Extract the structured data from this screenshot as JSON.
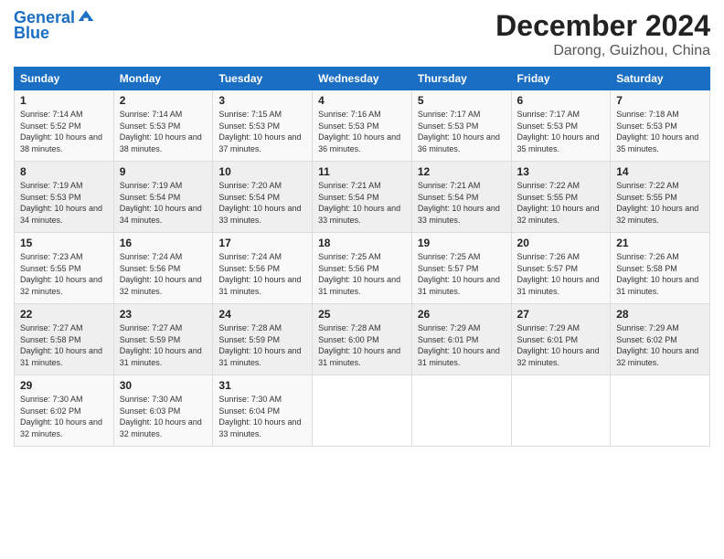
{
  "header": {
    "logo_line1": "General",
    "logo_line2": "Blue",
    "month": "December 2024",
    "location": "Darong, Guizhou, China"
  },
  "weekdays": [
    "Sunday",
    "Monday",
    "Tuesday",
    "Wednesday",
    "Thursday",
    "Friday",
    "Saturday"
  ],
  "weeks": [
    [
      {
        "day": "1",
        "sunrise": "Sunrise: 7:14 AM",
        "sunset": "Sunset: 5:52 PM",
        "daylight": "Daylight: 10 hours and 38 minutes."
      },
      {
        "day": "2",
        "sunrise": "Sunrise: 7:14 AM",
        "sunset": "Sunset: 5:53 PM",
        "daylight": "Daylight: 10 hours and 38 minutes."
      },
      {
        "day": "3",
        "sunrise": "Sunrise: 7:15 AM",
        "sunset": "Sunset: 5:53 PM",
        "daylight": "Daylight: 10 hours and 37 minutes."
      },
      {
        "day": "4",
        "sunrise": "Sunrise: 7:16 AM",
        "sunset": "Sunset: 5:53 PM",
        "daylight": "Daylight: 10 hours and 36 minutes."
      },
      {
        "day": "5",
        "sunrise": "Sunrise: 7:17 AM",
        "sunset": "Sunset: 5:53 PM",
        "daylight": "Daylight: 10 hours and 36 minutes."
      },
      {
        "day": "6",
        "sunrise": "Sunrise: 7:17 AM",
        "sunset": "Sunset: 5:53 PM",
        "daylight": "Daylight: 10 hours and 35 minutes."
      },
      {
        "day": "7",
        "sunrise": "Sunrise: 7:18 AM",
        "sunset": "Sunset: 5:53 PM",
        "daylight": "Daylight: 10 hours and 35 minutes."
      }
    ],
    [
      {
        "day": "8",
        "sunrise": "Sunrise: 7:19 AM",
        "sunset": "Sunset: 5:53 PM",
        "daylight": "Daylight: 10 hours and 34 minutes."
      },
      {
        "day": "9",
        "sunrise": "Sunrise: 7:19 AM",
        "sunset": "Sunset: 5:54 PM",
        "daylight": "Daylight: 10 hours and 34 minutes."
      },
      {
        "day": "10",
        "sunrise": "Sunrise: 7:20 AM",
        "sunset": "Sunset: 5:54 PM",
        "daylight": "Daylight: 10 hours and 33 minutes."
      },
      {
        "day": "11",
        "sunrise": "Sunrise: 7:21 AM",
        "sunset": "Sunset: 5:54 PM",
        "daylight": "Daylight: 10 hours and 33 minutes."
      },
      {
        "day": "12",
        "sunrise": "Sunrise: 7:21 AM",
        "sunset": "Sunset: 5:54 PM",
        "daylight": "Daylight: 10 hours and 33 minutes."
      },
      {
        "day": "13",
        "sunrise": "Sunrise: 7:22 AM",
        "sunset": "Sunset: 5:55 PM",
        "daylight": "Daylight: 10 hours and 32 minutes."
      },
      {
        "day": "14",
        "sunrise": "Sunrise: 7:22 AM",
        "sunset": "Sunset: 5:55 PM",
        "daylight": "Daylight: 10 hours and 32 minutes."
      }
    ],
    [
      {
        "day": "15",
        "sunrise": "Sunrise: 7:23 AM",
        "sunset": "Sunset: 5:55 PM",
        "daylight": "Daylight: 10 hours and 32 minutes."
      },
      {
        "day": "16",
        "sunrise": "Sunrise: 7:24 AM",
        "sunset": "Sunset: 5:56 PM",
        "daylight": "Daylight: 10 hours and 32 minutes."
      },
      {
        "day": "17",
        "sunrise": "Sunrise: 7:24 AM",
        "sunset": "Sunset: 5:56 PM",
        "daylight": "Daylight: 10 hours and 31 minutes."
      },
      {
        "day": "18",
        "sunrise": "Sunrise: 7:25 AM",
        "sunset": "Sunset: 5:56 PM",
        "daylight": "Daylight: 10 hours and 31 minutes."
      },
      {
        "day": "19",
        "sunrise": "Sunrise: 7:25 AM",
        "sunset": "Sunset: 5:57 PM",
        "daylight": "Daylight: 10 hours and 31 minutes."
      },
      {
        "day": "20",
        "sunrise": "Sunrise: 7:26 AM",
        "sunset": "Sunset: 5:57 PM",
        "daylight": "Daylight: 10 hours and 31 minutes."
      },
      {
        "day": "21",
        "sunrise": "Sunrise: 7:26 AM",
        "sunset": "Sunset: 5:58 PM",
        "daylight": "Daylight: 10 hours and 31 minutes."
      }
    ],
    [
      {
        "day": "22",
        "sunrise": "Sunrise: 7:27 AM",
        "sunset": "Sunset: 5:58 PM",
        "daylight": "Daylight: 10 hours and 31 minutes."
      },
      {
        "day": "23",
        "sunrise": "Sunrise: 7:27 AM",
        "sunset": "Sunset: 5:59 PM",
        "daylight": "Daylight: 10 hours and 31 minutes."
      },
      {
        "day": "24",
        "sunrise": "Sunrise: 7:28 AM",
        "sunset": "Sunset: 5:59 PM",
        "daylight": "Daylight: 10 hours and 31 minutes."
      },
      {
        "day": "25",
        "sunrise": "Sunrise: 7:28 AM",
        "sunset": "Sunset: 6:00 PM",
        "daylight": "Daylight: 10 hours and 31 minutes."
      },
      {
        "day": "26",
        "sunrise": "Sunrise: 7:29 AM",
        "sunset": "Sunset: 6:01 PM",
        "daylight": "Daylight: 10 hours and 31 minutes."
      },
      {
        "day": "27",
        "sunrise": "Sunrise: 7:29 AM",
        "sunset": "Sunset: 6:01 PM",
        "daylight": "Daylight: 10 hours and 32 minutes."
      },
      {
        "day": "28",
        "sunrise": "Sunrise: 7:29 AM",
        "sunset": "Sunset: 6:02 PM",
        "daylight": "Daylight: 10 hours and 32 minutes."
      }
    ],
    [
      {
        "day": "29",
        "sunrise": "Sunrise: 7:30 AM",
        "sunset": "Sunset: 6:02 PM",
        "daylight": "Daylight: 10 hours and 32 minutes."
      },
      {
        "day": "30",
        "sunrise": "Sunrise: 7:30 AM",
        "sunset": "Sunset: 6:03 PM",
        "daylight": "Daylight: 10 hours and 32 minutes."
      },
      {
        "day": "31",
        "sunrise": "Sunrise: 7:30 AM",
        "sunset": "Sunset: 6:04 PM",
        "daylight": "Daylight: 10 hours and 33 minutes."
      },
      null,
      null,
      null,
      null
    ]
  ]
}
